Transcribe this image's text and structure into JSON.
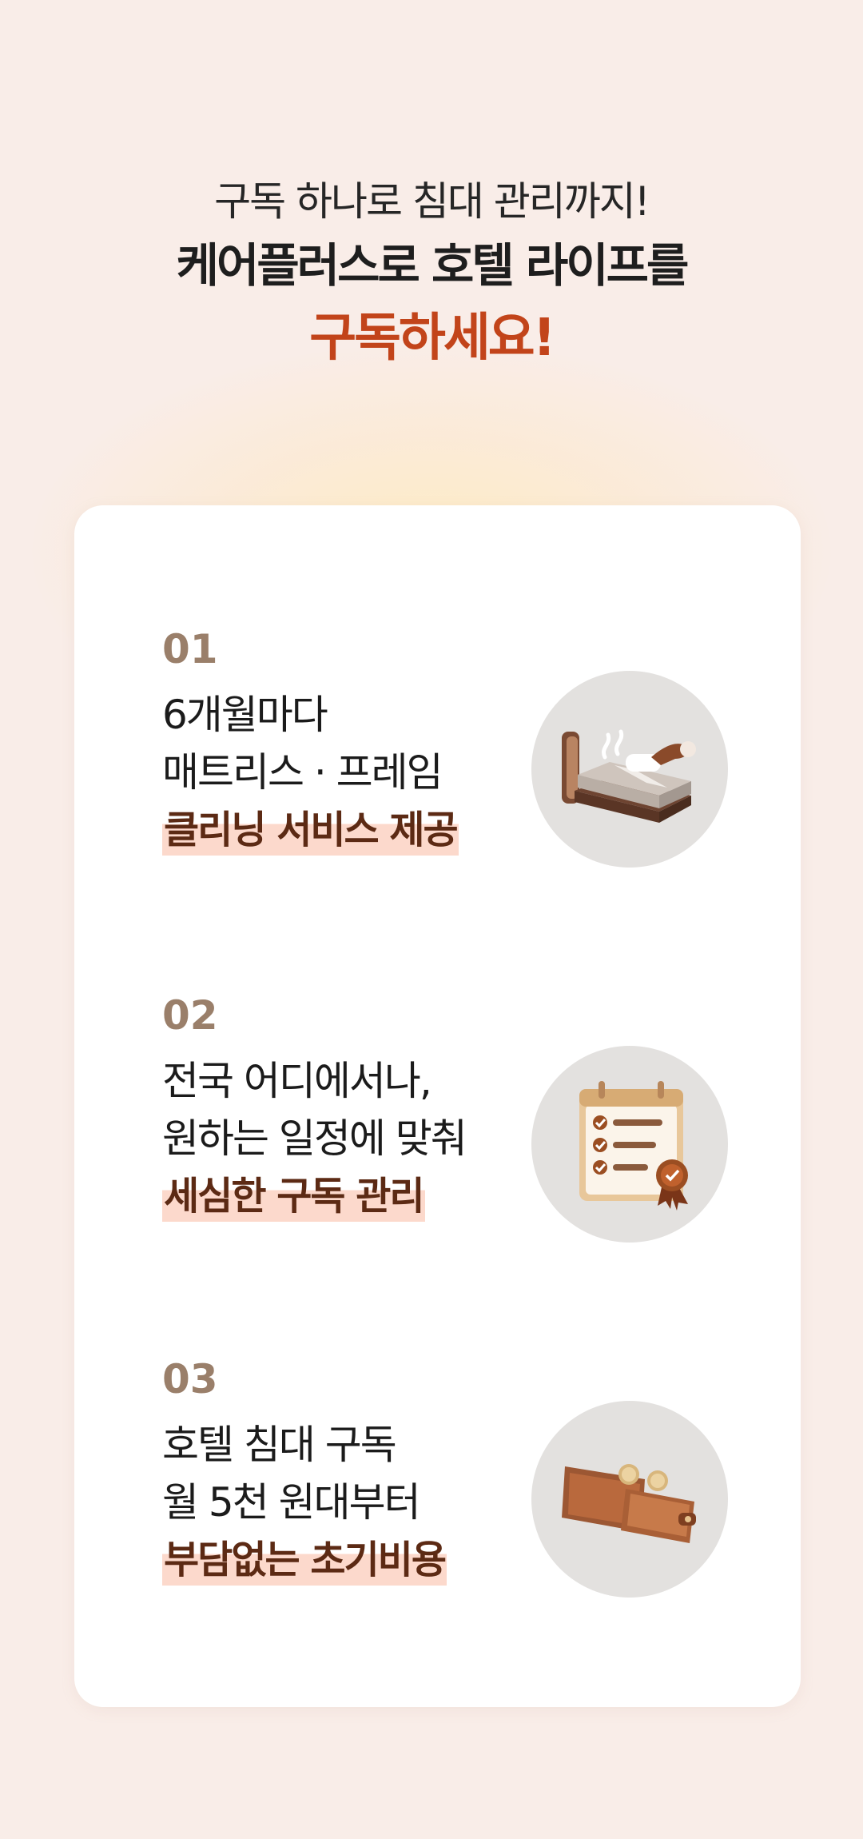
{
  "header": {
    "subtitle": "구독 하나로 침대 관리까지!",
    "title": "케어플러스로 호텔 라이프를",
    "accent": "구독하세요!"
  },
  "benefits": [
    {
      "number": "01",
      "line1": "6개월마다",
      "line2": "매트리스 · 프레임",
      "highlight": "클리닝 서비스 제공",
      "icon": "bed-cleaning-icon"
    },
    {
      "number": "02",
      "line1": "전국 어디에서나,",
      "line2": "원하는 일정에 맞춰",
      "highlight": "세심한 구독 관리",
      "icon": "checklist-calendar-icon"
    },
    {
      "number": "03",
      "line1": "호텔 침대 구독",
      "line2": "월 5천 원대부터",
      "highlight": "부담없는 초기비용",
      "icon": "wallet-icon"
    }
  ],
  "colors": {
    "background": "#f9ede8",
    "accent": "#c2441a",
    "number": "#9a7f6a",
    "highlight_text": "#5c2a14",
    "highlight_bg": "#fcd9cc",
    "icon_circle": "#e3e1df"
  }
}
